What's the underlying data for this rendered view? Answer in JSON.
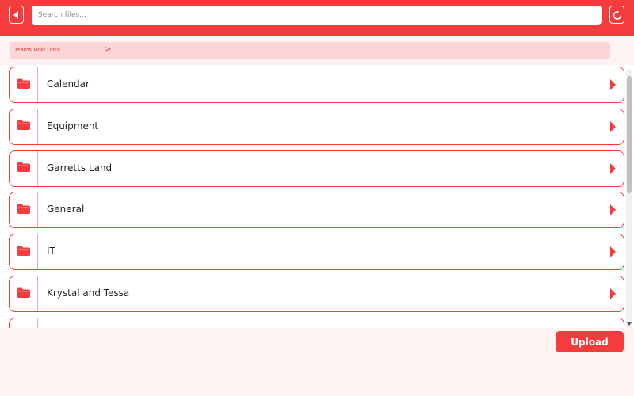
{
  "header": {
    "search_placeholder": "Search files...",
    "back_icon": "caret-left-icon",
    "refresh_icon": "refresh-icon"
  },
  "breadcrumb": {
    "items": [
      {
        "label": "Teams Wiki Data"
      }
    ],
    "separator": ">"
  },
  "folders": [
    {
      "label": "Calendar",
      "icon": "folder-icon"
    },
    {
      "label": "Equipment",
      "icon": "folder-icon"
    },
    {
      "label": "Garretts Land",
      "icon": "folder-icon"
    },
    {
      "label": "General",
      "icon": "folder-icon"
    },
    {
      "label": "IT",
      "icon": "folder-icon"
    },
    {
      "label": "Krystal and Tessa",
      "icon": "folder-icon"
    },
    {
      "label": "",
      "icon": "folder-icon"
    }
  ],
  "footer": {
    "upload_label": "Upload"
  },
  "colors": {
    "accent": "#f43c3e",
    "breadcrumb_bg": "#fcd5d6",
    "page_bg": "#fdf3f3"
  }
}
